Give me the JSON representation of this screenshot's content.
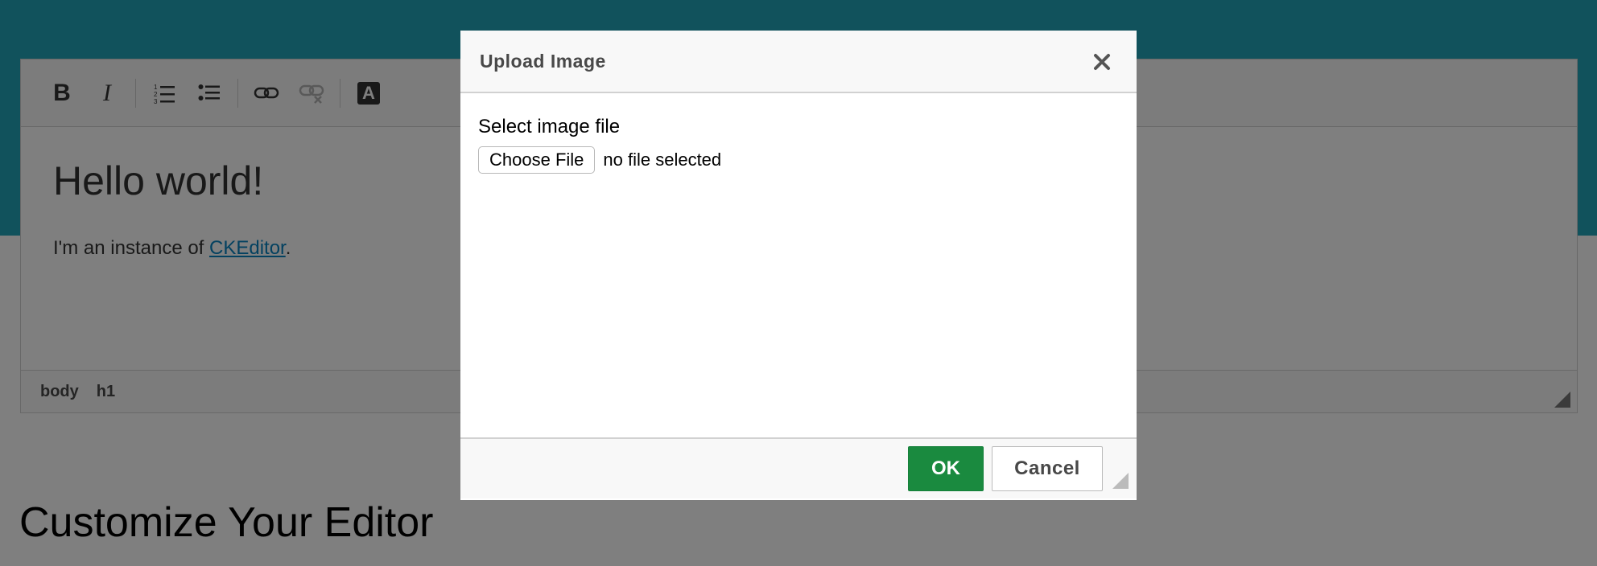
{
  "editor": {
    "toolbar": [
      {
        "name": "bold-button",
        "icon": "bold-icon",
        "label": "B"
      },
      {
        "name": "italic-button",
        "icon": "italic-icon",
        "label": "I"
      },
      {
        "name": "numbered-list-button",
        "icon": "numbered-list-icon"
      },
      {
        "name": "bulleted-list-button",
        "icon": "bulleted-list-icon"
      },
      {
        "name": "link-button",
        "icon": "link-icon"
      },
      {
        "name": "unlink-button",
        "icon": "unlink-icon",
        "disabled": true
      },
      {
        "name": "text-color-button",
        "icon": "text-color-icon",
        "label": "A"
      }
    ],
    "heading": "Hello world!",
    "paragraph_prefix": "I'm an instance of ",
    "paragraph_link": "CKEditor",
    "paragraph_suffix": ".",
    "path": [
      "body",
      "h1"
    ]
  },
  "section_title": "Customize Your Editor",
  "dialog": {
    "title": "Upload Image",
    "close_icon": "close-icon",
    "field_label": "Select image file",
    "choose_file_label": "Choose File",
    "file_status": "no file selected",
    "ok_label": "OK",
    "cancel_label": "Cancel"
  },
  "colors": {
    "header_bg": "#22a4b8",
    "ok_bg": "#1a8a3f",
    "link": "#0782c1"
  }
}
